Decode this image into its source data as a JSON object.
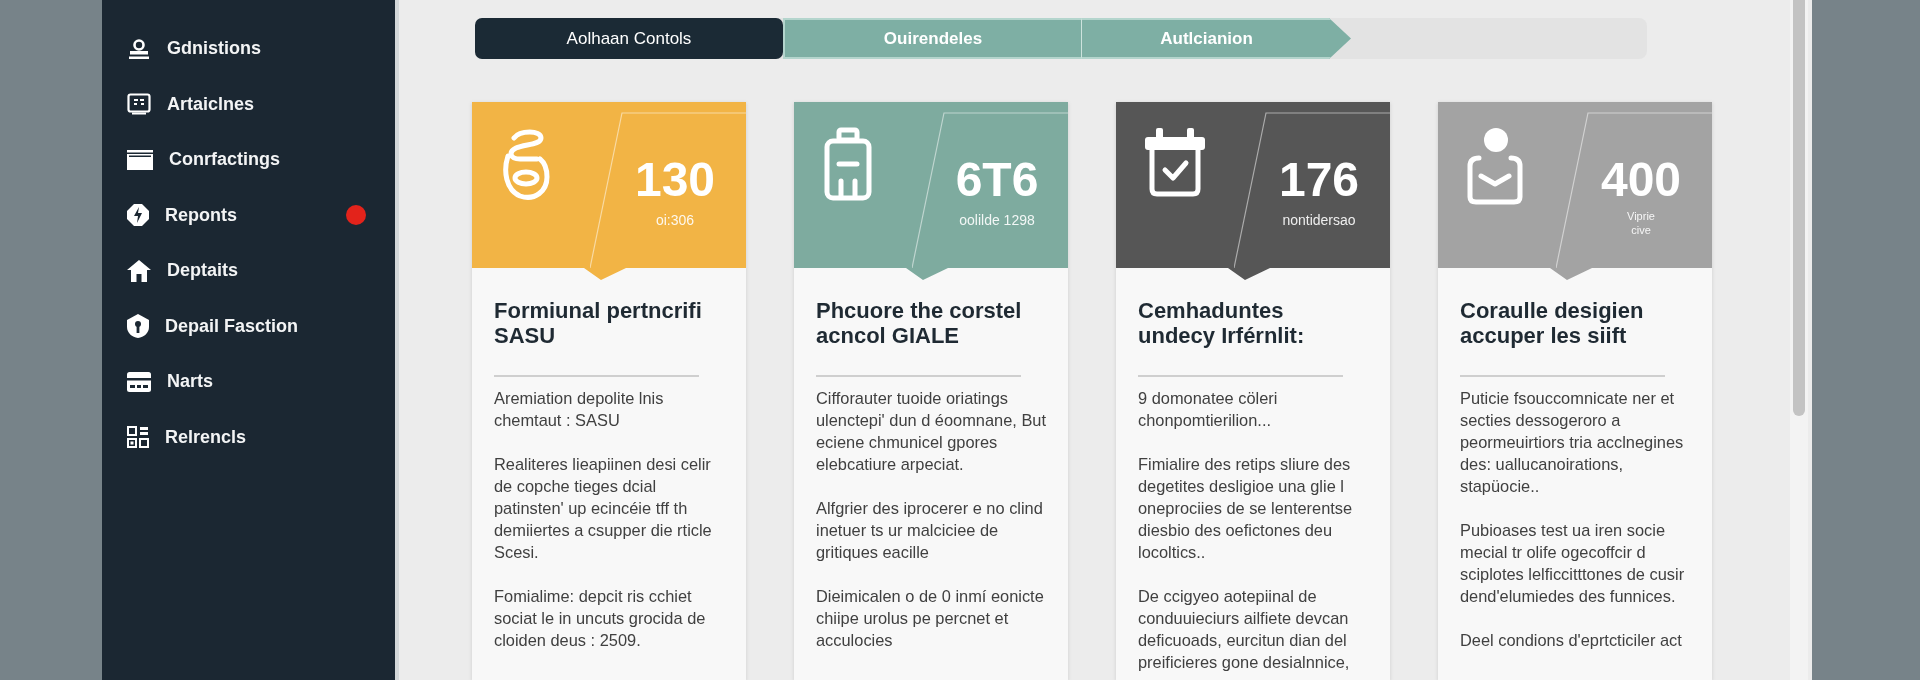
{
  "sidebar": {
    "items": [
      {
        "label": "Gdnistions",
        "alert": false
      },
      {
        "label": "Artaiclnes",
        "alert": false
      },
      {
        "label": "Conrfactings",
        "alert": false
      },
      {
        "label": "Reponts",
        "alert": true
      },
      {
        "label": "Deptaits",
        "alert": false
      },
      {
        "label": "Depail Fasction",
        "alert": false
      },
      {
        "label": "Narts",
        "alert": false
      },
      {
        "label": "Relrencls",
        "alert": false
      }
    ]
  },
  "stepper": {
    "steps": [
      {
        "label": "Aolhaan Contols",
        "selected": true
      },
      {
        "label": "Ouirendeles",
        "selected": false
      },
      {
        "label": "Autlcianion",
        "selected": false
      }
    ]
  },
  "cards": [
    {
      "color": "#f2b445",
      "value": "130",
      "caption": [
        "oi:306"
      ],
      "title": "Formiunal pertncrifi SASU",
      "paragraphs": [
        "Aremiation depolite lnis chemtaut : SASU",
        "Realiteres lieapiinen desi celir de copche tieges dcial patinsten' up ecincéie tff th demiiertes a csupper die rticle Scesi.",
        "Fomialime: depcit ris cchiet sociat le in uncuts grocida de cloiden deus : 2509."
      ]
    },
    {
      "color": "#7eab9f",
      "value": "6T6",
      "caption": [
        "oolilde 1298"
      ],
      "title": "Phcuore the corstel acncol GIALE",
      "paragraphs": [
        "Cifforauter tuoide oriatings ulenctepi' dun d éoomnane, But eciene chmunicel gpores elebcatiure arpeciat.",
        "Alfgrier des iprocerer e no clind inetuer ts ur malciciee de gritiques eacille",
        "Dieimicalen o de 0 inmí eonicte chiipe urolus pe percnet et acculocies"
      ]
    },
    {
      "color": "#565656",
      "value": "176",
      "caption": [
        "nontidersao"
      ],
      "title": "Cemhaduntes undecy Irférnlit:",
      "paragraphs": [
        "9 domonatee cöleri chonpomtierilion...",
        "Fimialire des retips sliure des degetites desligioe una glie l oneprociies de se lenterentse diesbio des oefictones deu locoltics..",
        "De ccigyeo aotepiinal de conduuieciurs ailfiete devcan deficuoads, eurcitun dian del preificieres gone desialnnice,"
      ]
    },
    {
      "color": "#a3a3a3",
      "value": "400",
      "caption": [
        "Viprie",
        "cive"
      ],
      "title": "Coraulle desigien accuper les siift",
      "paragraphs": [
        "Puticie fsouccomnicate ner et secties dessogeroro a peormeuirtiors tria acclnegines des: uallucanoirations, stapüocie..",
        "Pubioases test ua iren socie mecial tr olife ogecoffcir d sciplotes lelficcitttones de cusir dend'elumiedes des funnices.",
        "Deel condions d'eprtcticiler act"
      ]
    }
  ]
}
